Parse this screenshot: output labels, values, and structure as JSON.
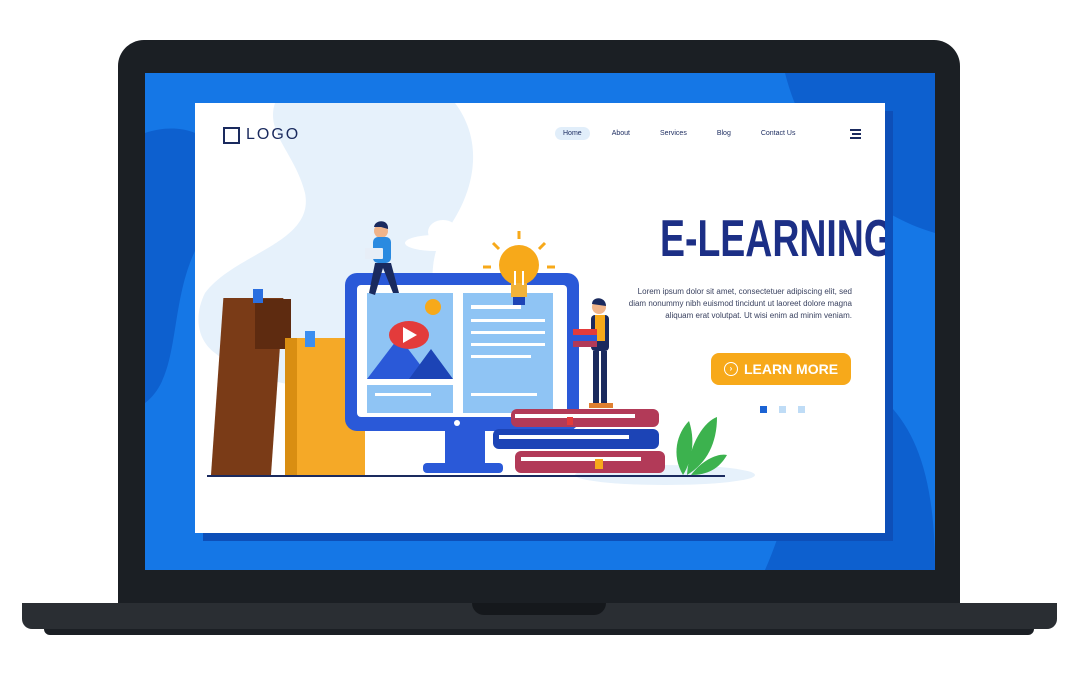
{
  "logo": {
    "text": "LOGO"
  },
  "nav": {
    "items": [
      {
        "label": "Home",
        "active": true
      },
      {
        "label": "About"
      },
      {
        "label": "Services"
      },
      {
        "label": "Blog"
      },
      {
        "label": "Contact Us"
      }
    ],
    "menu_icon": "hamburger-icon"
  },
  "hero": {
    "title": "E-LEARNING",
    "description": "Lorem ipsum dolor sit amet, consectetuer adipiscing elit, sed diam nonummy nibh euismod tincidunt ut laoreet dolore magna aliquam erat volutpat. Ut wisi enim ad minim veniam.",
    "cta_label": "LEARN MORE"
  },
  "carousel": {
    "dot_count": 3,
    "active_index": 0
  },
  "colors": {
    "accent": "#f7a91a",
    "title": "#1c2f86",
    "screen_bg": "#1577e6",
    "active_dot": "#1b63d4"
  }
}
